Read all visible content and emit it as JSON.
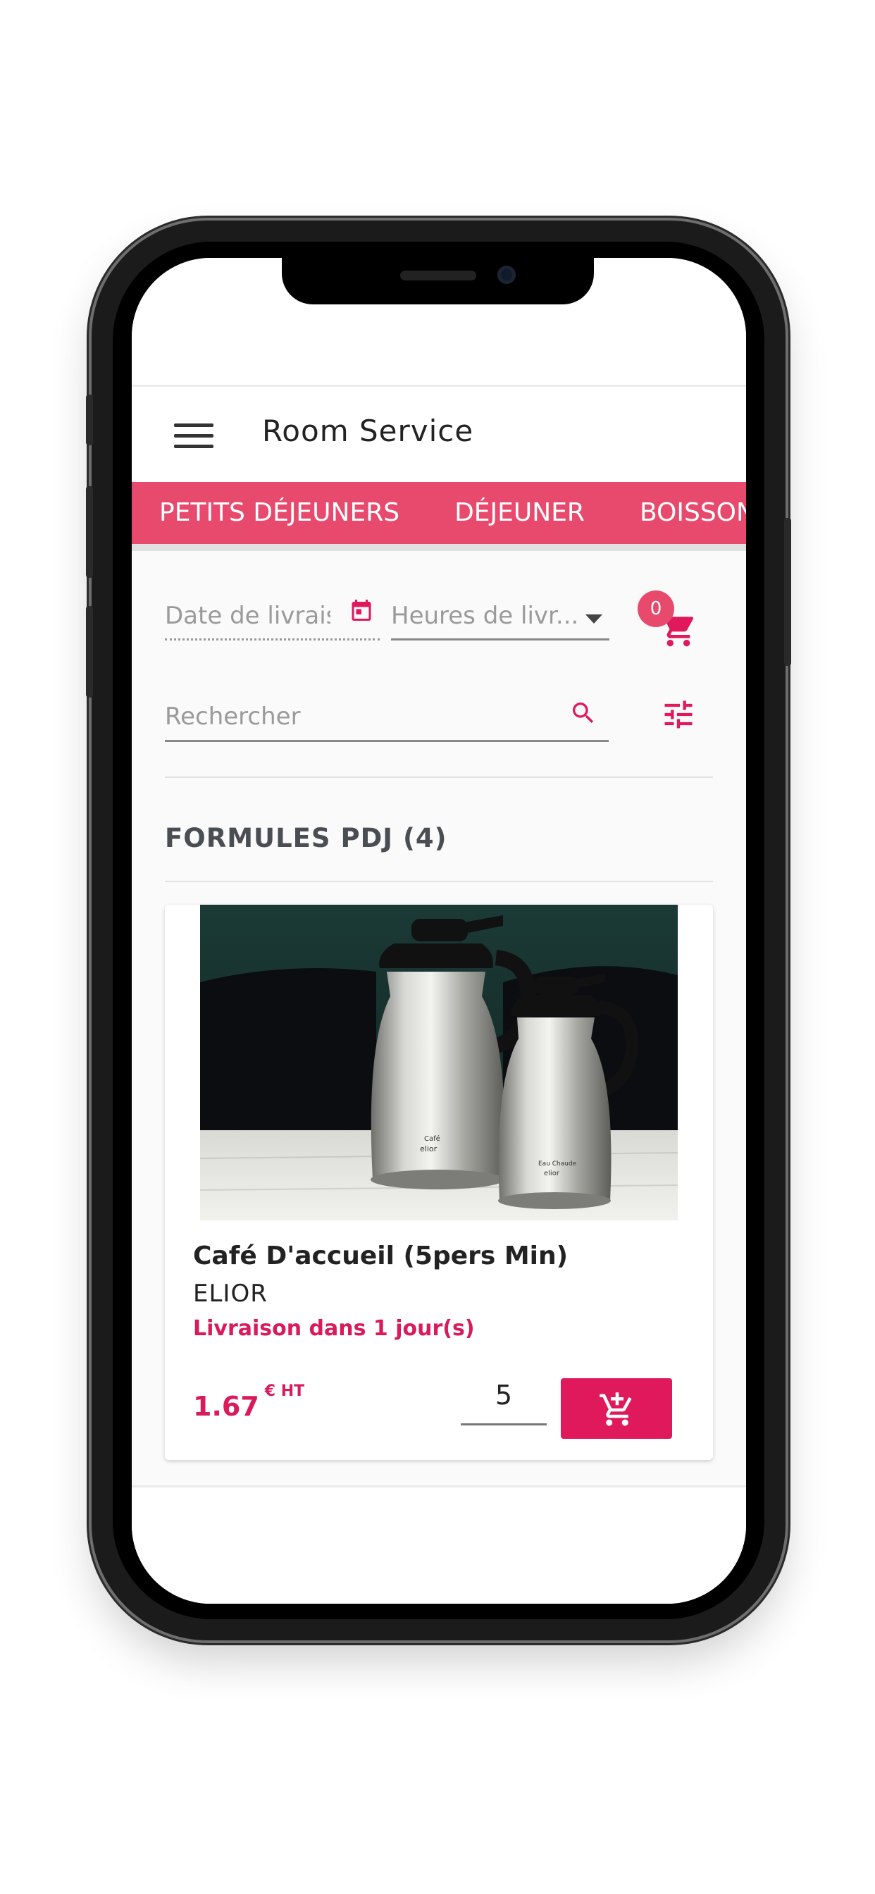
{
  "app": {
    "title": "Room Service"
  },
  "tabs": [
    {
      "label": "PETITS DÉJEUNERS"
    },
    {
      "label": "DÉJEUNER"
    },
    {
      "label": "BOISSONS"
    }
  ],
  "filters": {
    "date_placeholder": "Date de livraison",
    "hours_placeholder": "Heures de livr...",
    "search_placeholder": "Rechercher"
  },
  "cart": {
    "count": "0"
  },
  "section": {
    "title": "FORMULES PDJ (4)"
  },
  "product": {
    "name": "Café D'accueil (5pers Min)",
    "brand": "ELIOR",
    "delivery": "Livraison dans 1 jour(s)",
    "price": "1.67",
    "price_unit": "€ HT",
    "quantity": "5"
  },
  "icons": {
    "menu": "hamburger-menu-icon",
    "calendar": "calendar-icon",
    "cart": "shopping-cart-icon",
    "search": "search-icon",
    "filter": "tune-filter-icon",
    "add_to_cart": "add-shopping-cart-icon"
  },
  "colors": {
    "accent": "#e84a6e",
    "primary": "#e0195c",
    "delivery_text": "#d91b5c"
  }
}
